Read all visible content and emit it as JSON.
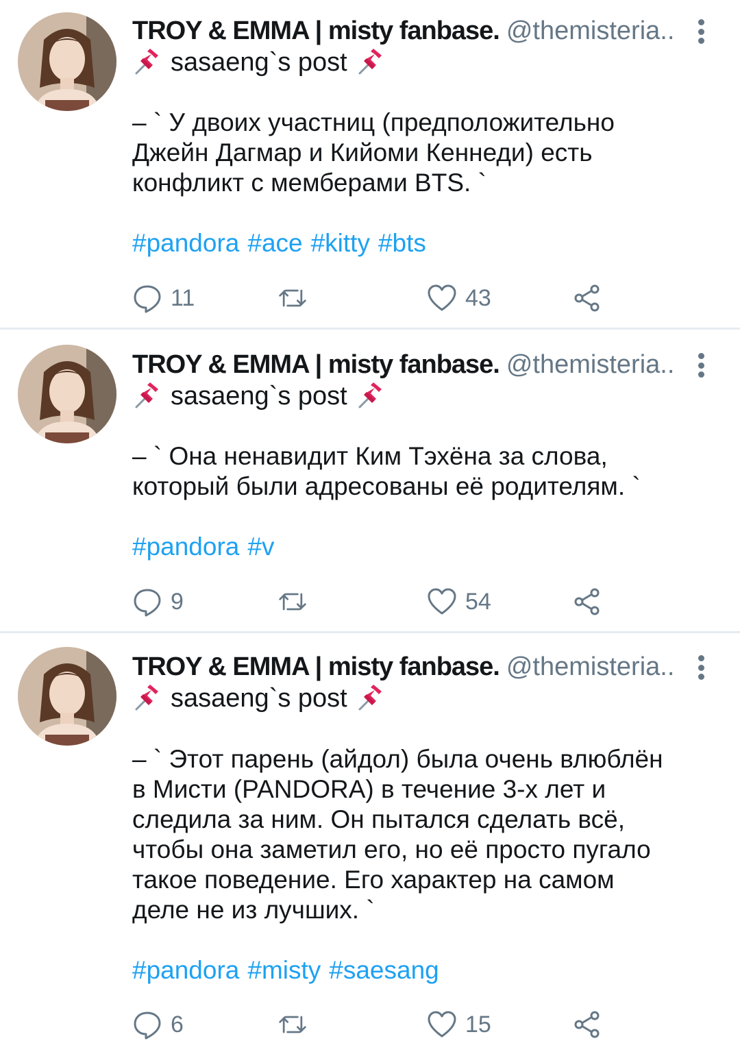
{
  "tweets": [
    {
      "name": "TROY & EMMA | misty fanbase.",
      "handle": "@themisteria..",
      "subline": "sasaeng`s post",
      "body": [
        "– ` У двоих участниц (предположительно",
        "Джейн Дагмар и Кийоми Кеннеди) есть",
        "конфликт с мемберами BTS. `"
      ],
      "hashtags": [
        "#pandora",
        "#ace",
        "#kitty",
        "#bts"
      ],
      "replies": "11",
      "retweets": "",
      "likes": "43"
    },
    {
      "name": "TROY & EMMA | misty fanbase.",
      "handle": "@themisteria..",
      "subline": "sasaeng`s post",
      "body": [
        "– ` Она ненавидит Ким Тэхёна за слова,",
        "который были адресованы её родителям. `"
      ],
      "hashtags": [
        "#pandora",
        "#v"
      ],
      "replies": "9",
      "retweets": "",
      "likes": "54"
    },
    {
      "name": "TROY & EMMA | misty fanbase.",
      "handle": "@themisteria..",
      "subline": "sasaeng`s post",
      "body": [
        "– ` Этот парень (айдол) была очень влюблён",
        "в Мисти (PANDORA) в течение 3-х лет и",
        "следила за ним. Он пытался сделать всё,",
        "чтобы она заметил его, но её просто пугало",
        "такое поведение. Его характер на самом",
        "деле не из лучших. `"
      ],
      "hashtags": [
        "#pandora",
        "#misty",
        "#saesang"
      ],
      "replies": "6",
      "retweets": "",
      "likes": "15"
    }
  ],
  "icons": {
    "pin": "pushpin-icon",
    "reply": "reply-icon",
    "retweet": "retweet-icon",
    "like": "heart-icon",
    "share": "share-icon",
    "more": "more-vertical-icon"
  },
  "colors": {
    "hashtag": "#1da1f2",
    "secondary": "#657786",
    "divider": "#e6ecf0",
    "pin": "#e0245e"
  }
}
